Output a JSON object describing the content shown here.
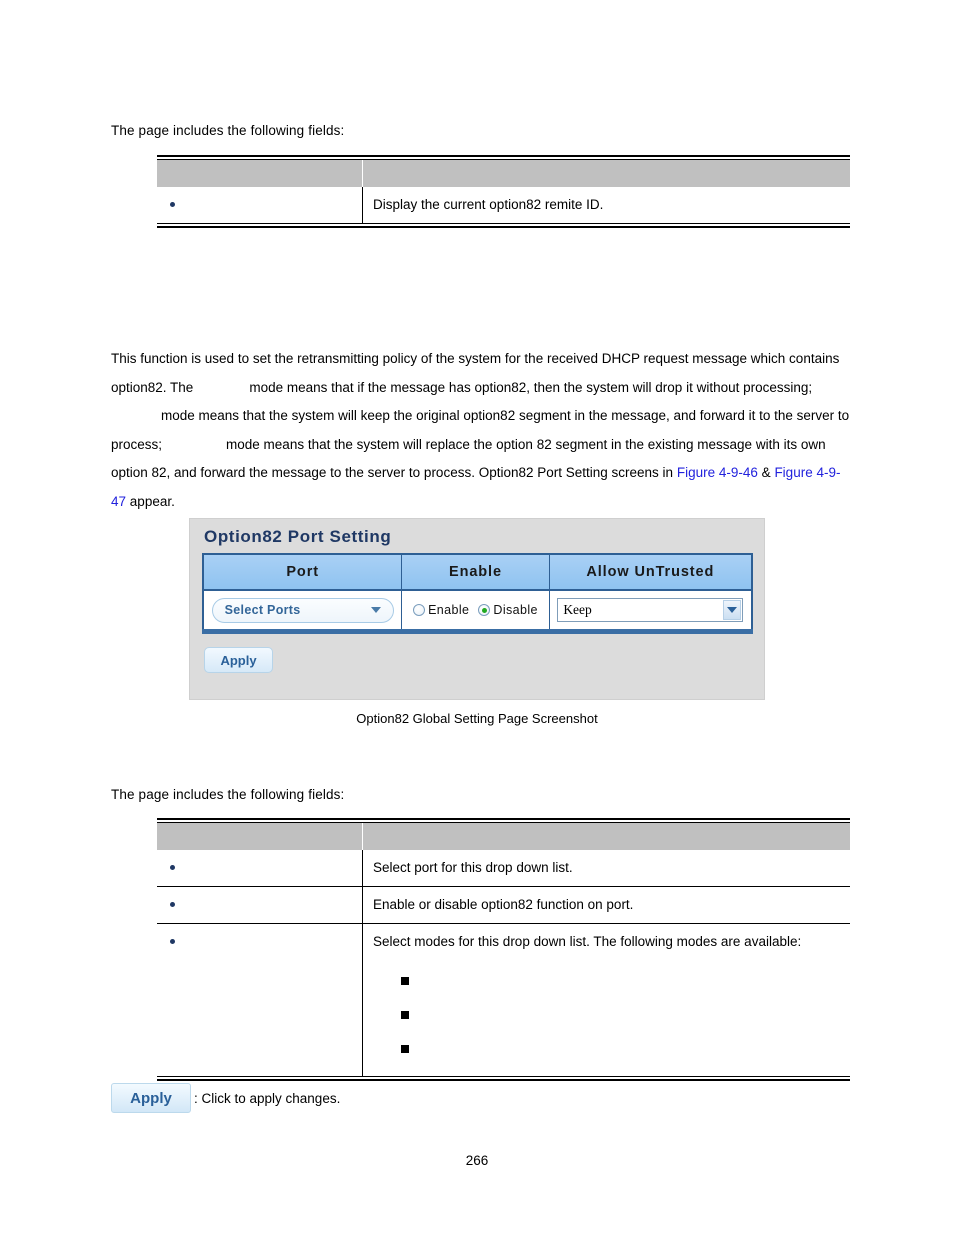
{
  "document": {
    "page_number": "266",
    "intro_text_1": "The page includes the following fields:",
    "intro_text_2": "The page includes the following fields:"
  },
  "table_1": {
    "headers": [
      "",
      ""
    ],
    "rows": [
      {
        "object": "",
        "description": "Display the current option82 remite ID."
      }
    ]
  },
  "description": {
    "part1": "This function is used to set the retransmitting policy of the system for the received DHCP request message which contains option82. The",
    "mode_drop": "",
    "part2": "mode means that if the message has option82, then the system will drop it without processing;",
    "mode_keep": "",
    "part3": "mode means that the system will keep the original option82 segment in the message, and forward it to the server to process;",
    "mode_replace": "",
    "part4": "mode means that the system will replace the option 82 segment in the existing message with its own option 82, and forward the message to the server to process. Option82 Port Setting screens in",
    "link_1": "Figure 4-9-46",
    "link_separator": "&",
    "link_2": "Figure 4-9-47",
    "part5": "appear.",
    "link_color": "#2222dd"
  },
  "screenshot": {
    "panel_title": "Option82 Port Setting",
    "table_headers": [
      "Port",
      "Enable",
      "Allow UnTrusted"
    ],
    "port_select": {
      "label": "Select Ports"
    },
    "enable_radio": {
      "option_enable": "Enable",
      "option_disable": "Disable",
      "selected": "Disable"
    },
    "allow_untrusted_select": {
      "value": "Keep"
    },
    "apply_label": "Apply",
    "caption": "Option82 Global Setting Page Screenshot",
    "accent_border": "#2e5f94",
    "header_fill": "#8fc3f0",
    "panel_fill": "#dcdcdc",
    "title_color": "#1f3864"
  },
  "table_2": {
    "headers": [
      "",
      ""
    ],
    "rows": [
      {
        "object": "",
        "description": "Select port for this drop down list."
      },
      {
        "object": "",
        "description": "Enable or disable option82 function on port."
      },
      {
        "object": "",
        "description": "Select modes for this drop down list. The following modes are available:",
        "sub_items": [
          "",
          "",
          ""
        ]
      }
    ]
  },
  "apply_legend": {
    "button_label": "Apply",
    "text": ": Click to apply changes."
  }
}
